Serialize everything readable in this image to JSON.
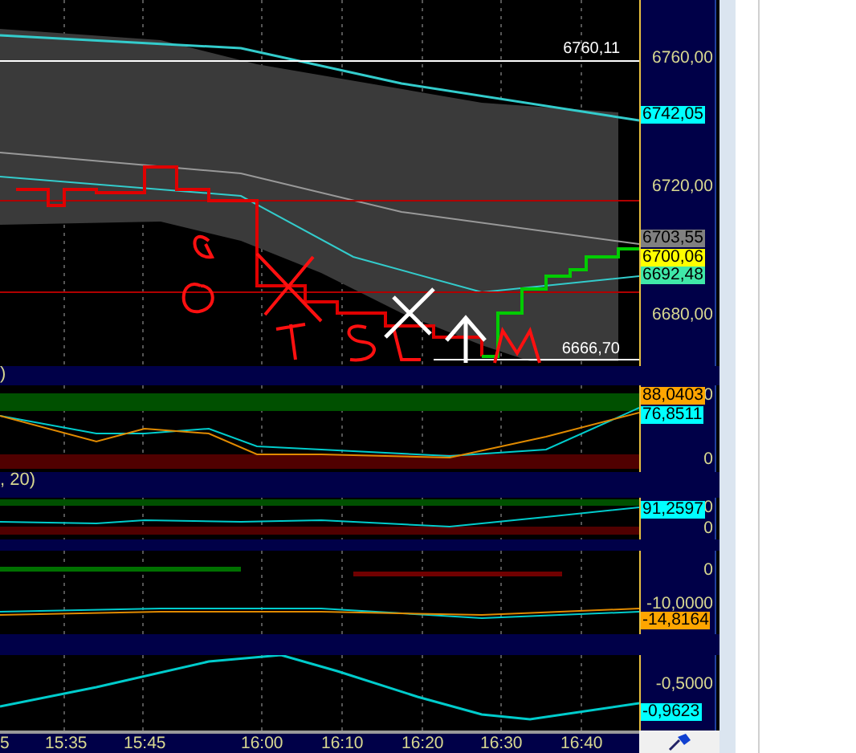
{
  "panes": [
    {
      "kind": "price",
      "axis_labels": [
        "6760,00",
        "6720,00",
        "6680,00"
      ],
      "line_labels": [
        "6760,11",
        "6666,70"
      ],
      "tags": [
        {
          "text": "6742,05",
          "color": "#00ffff"
        },
        {
          "text": "6703,55",
          "color": "#808080"
        },
        {
          "text": "6700,06",
          "color": "#ffff00"
        },
        {
          "text": "6692,48",
          "color": "#40e8a8"
        }
      ]
    },
    {
      "kind": "bands",
      "header": ")",
      "axis_labels": [
        "0",
        "0"
      ],
      "tags": [
        {
          "text": "88,0403",
          "color": "#ffa500"
        },
        {
          "text": "76,8511",
          "color": "#00ffff"
        }
      ]
    },
    {
      "kind": "thin",
      "header": ", 20)",
      "axis_labels": [
        "0",
        "0"
      ],
      "tags": [
        {
          "text": "91,2597",
          "color": "#00ffff"
        }
      ]
    },
    {
      "kind": "momentum",
      "axis_labels": [
        "0",
        "-10,0000"
      ],
      "tags": [
        {
          "text": "-14,8164",
          "color": "#ffa500"
        }
      ]
    },
    {
      "kind": "line",
      "axis_labels": [
        "-0,5000"
      ],
      "tags": [
        {
          "text": "-0,9623",
          "color": "#00ffff"
        }
      ]
    }
  ],
  "time_axis": [
    "5",
    "15:35",
    "15:45",
    "16:00",
    "16:10",
    "16:20",
    "16:30",
    "16:40"
  ]
}
